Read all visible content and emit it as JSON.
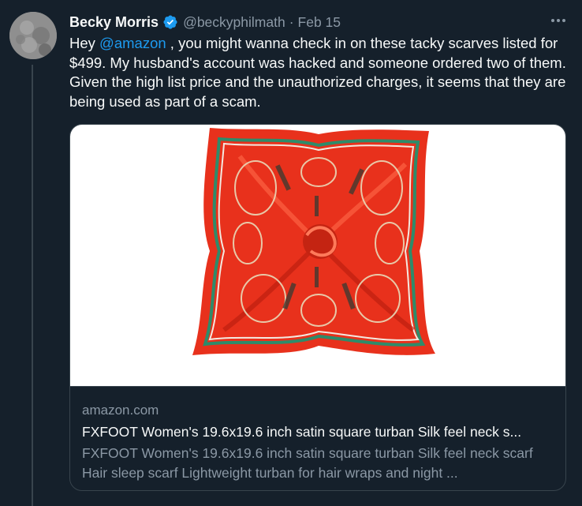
{
  "tweet": {
    "author": {
      "display_name": "Becky Morris",
      "handle": "@beckyphilmath",
      "verified": true
    },
    "separator": "·",
    "date": "Feb 15",
    "text": {
      "prefix": "Hey ",
      "mention": "@amazon",
      "body": " , you might wanna check in on these tacky scarves listed for $499. My husband's account was hacked and someone ordered two of them. Given the high list price and the unauthorized charges, it seems that they are being used as part of a scam."
    }
  },
  "card": {
    "domain": "amazon.com",
    "title": "FXFOOT Women's 19.6x19.6 inch satin square turban Silk feel neck s...",
    "description": "FXFOOT Women's 19.6x19.6 inch satin square turban Silk feel neck scarf Hair sleep scarf Lightweight turban for hair wraps and night ..."
  },
  "colors": {
    "background": "#15202b",
    "primary_text": "#f7f9f9",
    "secondary_text": "#8b98a5",
    "accent": "#1d9bf0",
    "border": "#38444d",
    "scarf_red": "#e8311c",
    "scarf_stripe": "#2e8b6a"
  },
  "icons": {
    "verified": "verified-badge-icon",
    "more": "more-options-icon"
  }
}
